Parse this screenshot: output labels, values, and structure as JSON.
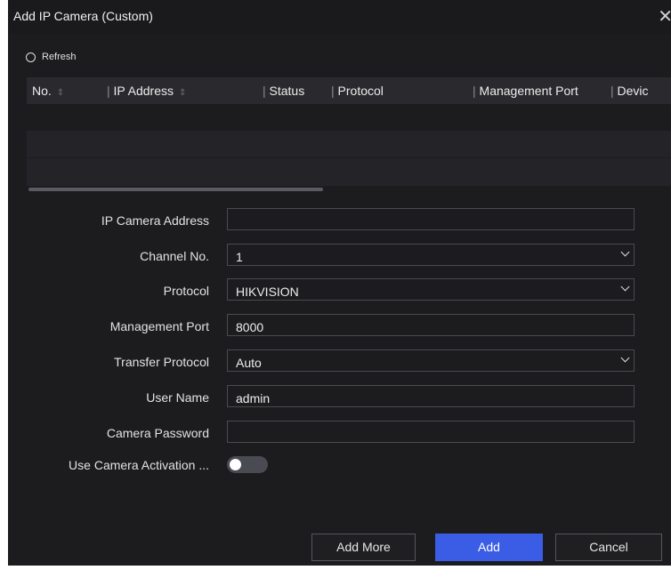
{
  "dialog": {
    "title": "Add IP Camera (Custom)",
    "close_icon": "close-icon"
  },
  "toolbar": {
    "refresh_label": "Refresh"
  },
  "table": {
    "columns": [
      "No.",
      "IP Address",
      "Status",
      "Protocol",
      "Management Port",
      "Devic"
    ],
    "rows": []
  },
  "form": {
    "ip_address": {
      "label": "IP Camera Address",
      "value": ""
    },
    "channel_no": {
      "label": "Channel No.",
      "value": "1"
    },
    "protocol": {
      "label": "Protocol",
      "value": "HIKVISION"
    },
    "management_port": {
      "label": "Management Port",
      "value": "8000"
    },
    "transfer_protocol": {
      "label": "Transfer Protocol",
      "value": "Auto"
    },
    "user_name": {
      "label": "User Name",
      "value": "admin"
    },
    "camera_password": {
      "label": "Camera Password",
      "value": ""
    },
    "activation": {
      "label": "Use Camera Activation ...",
      "enabled": false
    }
  },
  "buttons": {
    "add_more": "Add More",
    "add": "Add",
    "cancel": "Cancel"
  },
  "colors": {
    "accent": "#3b5ce5",
    "background": "#1c1c1f"
  }
}
